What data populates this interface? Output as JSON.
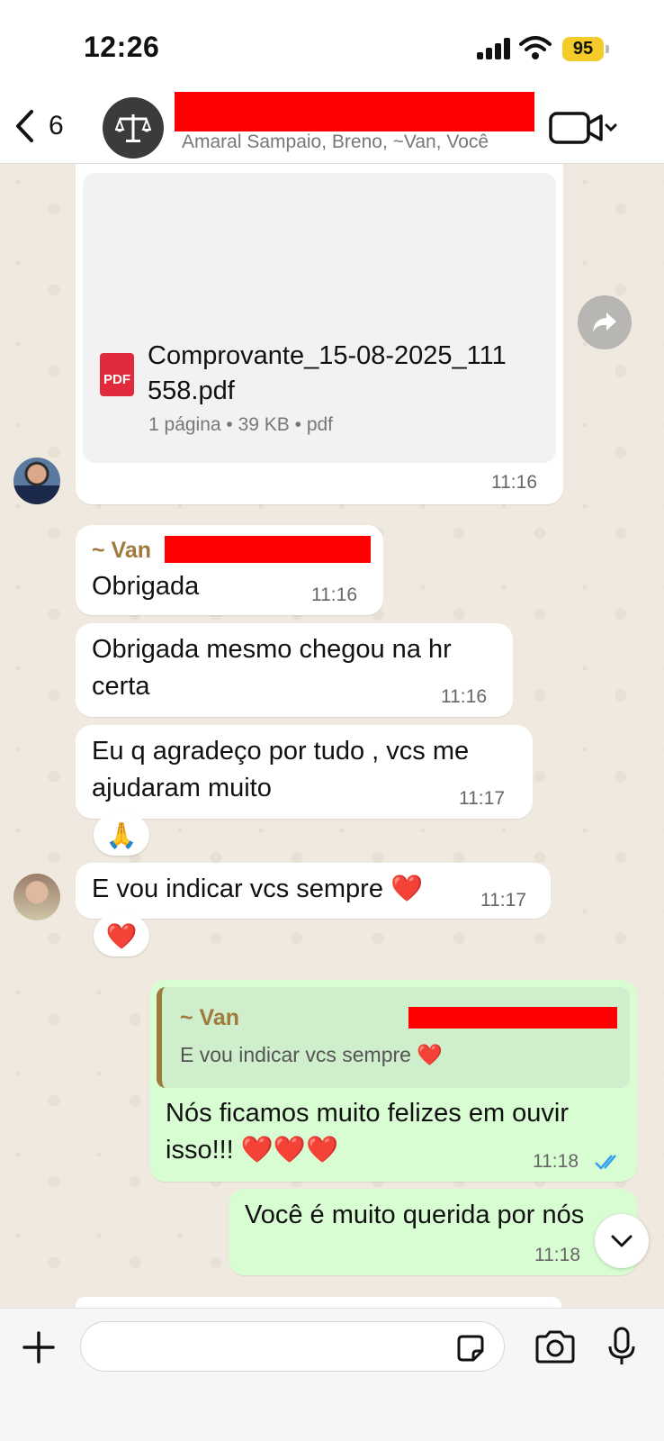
{
  "status_bar": {
    "time": "12:26",
    "battery": "95"
  },
  "header": {
    "back_count": "6",
    "members": "Amaral Sampaio, Breno, ~Van, Você"
  },
  "document": {
    "file_name": "Comprovante_15-08-2025_111558.pdf",
    "file_name_line1": "Comprovante_15-08-2025_111",
    "file_name_line2": "558.pdf",
    "meta": "1 página • 39 KB • pdf",
    "icon_label": "PDF",
    "time": "11:16"
  },
  "messages": [
    {
      "sender": "~ Van",
      "text": "Obrigada",
      "time": "11:16"
    },
    {
      "text_line1": "Obrigada mesmo chegou na hr",
      "text_line2": "certa",
      "time": "11:16"
    },
    {
      "text_line1": "Eu q agradeço por tudo , vcs me",
      "text_line2": "ajudaram muito",
      "time": "11:17",
      "reaction": "🙏"
    },
    {
      "text": "E vou indicar vcs sempre ❤️",
      "time": "11:17",
      "reaction": "❤️"
    }
  ],
  "outgoing": [
    {
      "quote_sender": "~ Van",
      "quote_text": "E vou indicar vcs sempre ❤️",
      "text_line1": "Nós ficamos muito felizes em ouvir",
      "text_line2": "isso!!! ❤️❤️❤️",
      "time": "11:18"
    },
    {
      "text": "Você é muito querida por nós",
      "time": "11:18"
    }
  ],
  "colors": {
    "sender": "#a07a3c",
    "outgoing_bg": "#d9fdd3",
    "read_tick": "#34a0f0",
    "redaction": "#ff0000"
  }
}
